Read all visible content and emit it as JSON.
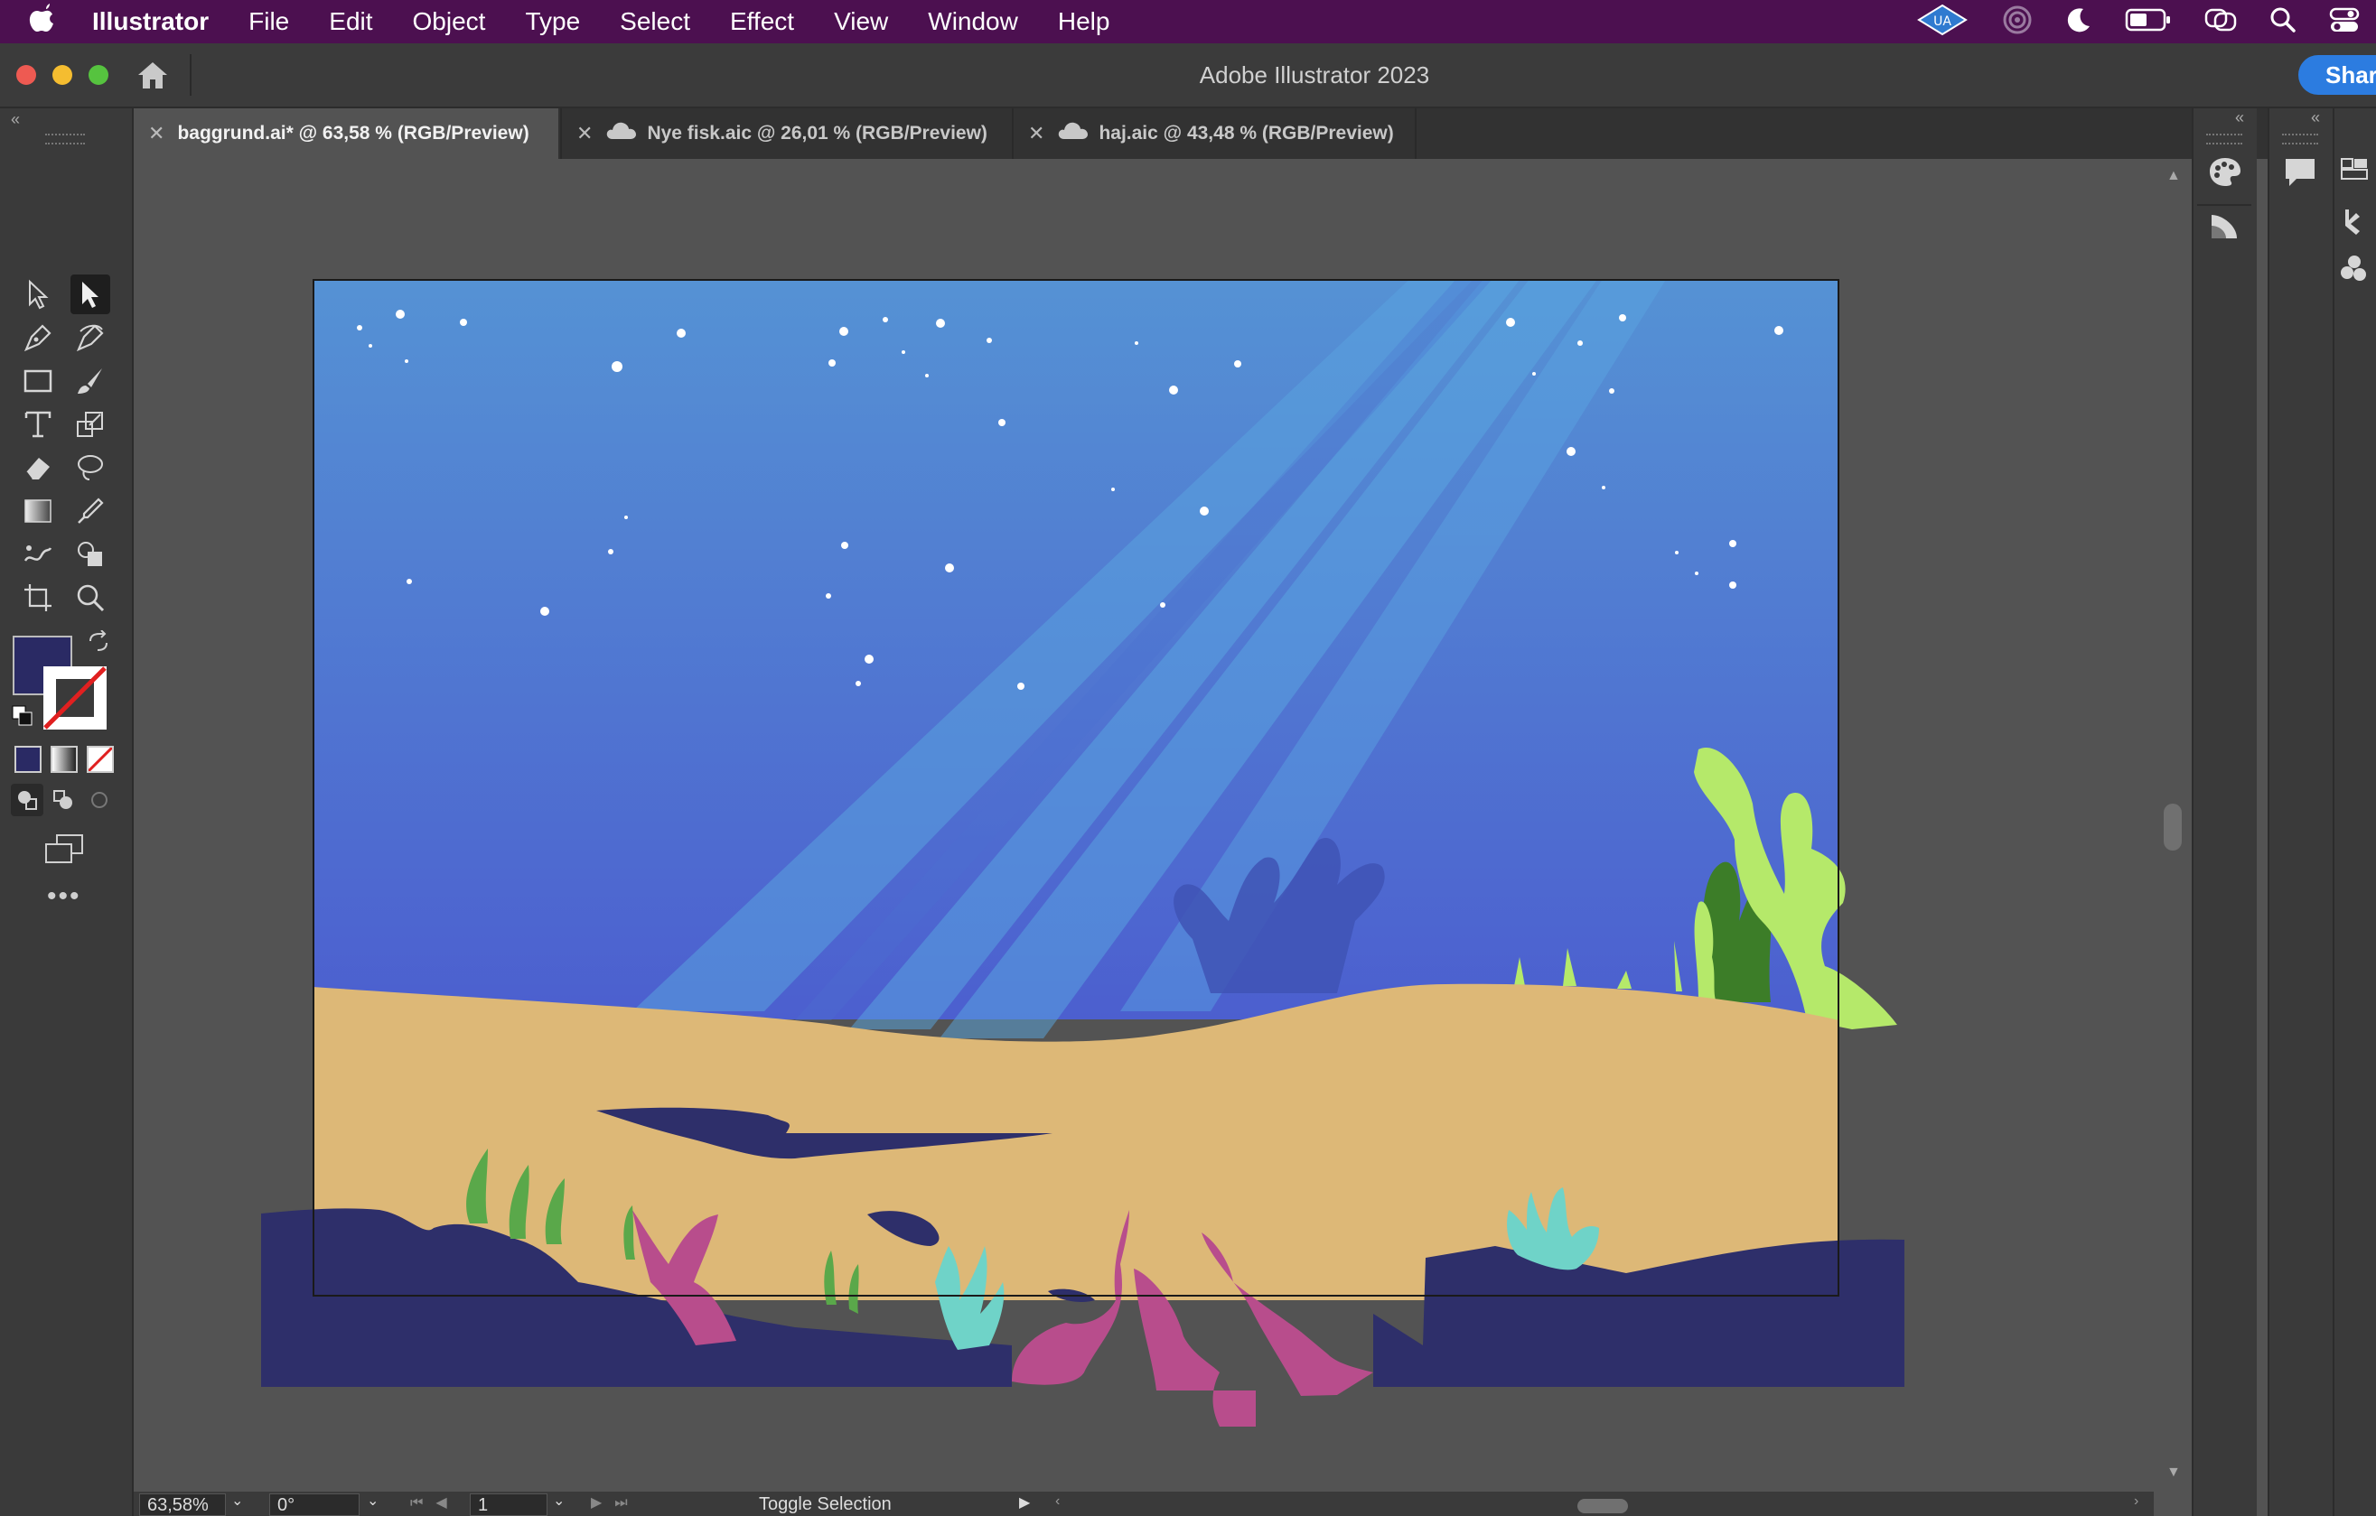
{
  "menubar": {
    "app_name": "Illustrator",
    "items": [
      "File",
      "Edit",
      "Object",
      "Type",
      "Select",
      "Effect",
      "View",
      "Window",
      "Help"
    ],
    "status_icons": [
      "ua-extension-icon",
      "airdrop-icon",
      "night-mode-icon",
      "battery-icon",
      "screen-mirroring-icon",
      "search-icon",
      "control-center-icon"
    ]
  },
  "window": {
    "title": "Adobe Illustrator 2023",
    "share_label": "Share"
  },
  "tabs": [
    {
      "label": "baggrund.ai* @ 63,58 % (RGB/Preview)",
      "active": true,
      "cloud": false
    },
    {
      "label": "Nye fisk.aic @ 26,01 % (RGB/Preview)",
      "active": false,
      "cloud": true
    },
    {
      "label": "haj.aic @ 43,48 % (RGB/Preview)",
      "active": false,
      "cloud": true
    }
  ],
  "tools": {
    "fill_color": "#2a2a64",
    "stroke": "none"
  },
  "statusbar": {
    "zoom": "63,58%",
    "rotation": "0°",
    "artboard": "1",
    "status_text": "Toggle Selection"
  },
  "colors": {
    "accent": "#2c7ce0",
    "menubar_bg": "#4c1050",
    "sky_top": "#5592d4",
    "sky_bottom": "#4e5fcc",
    "sand": "#ddb877",
    "rocks": "#2e2f6a",
    "coral_pink": "#b84d8c",
    "seaweed_light": "#b5e96a",
    "seaweed_dark": "#3c7d28"
  }
}
